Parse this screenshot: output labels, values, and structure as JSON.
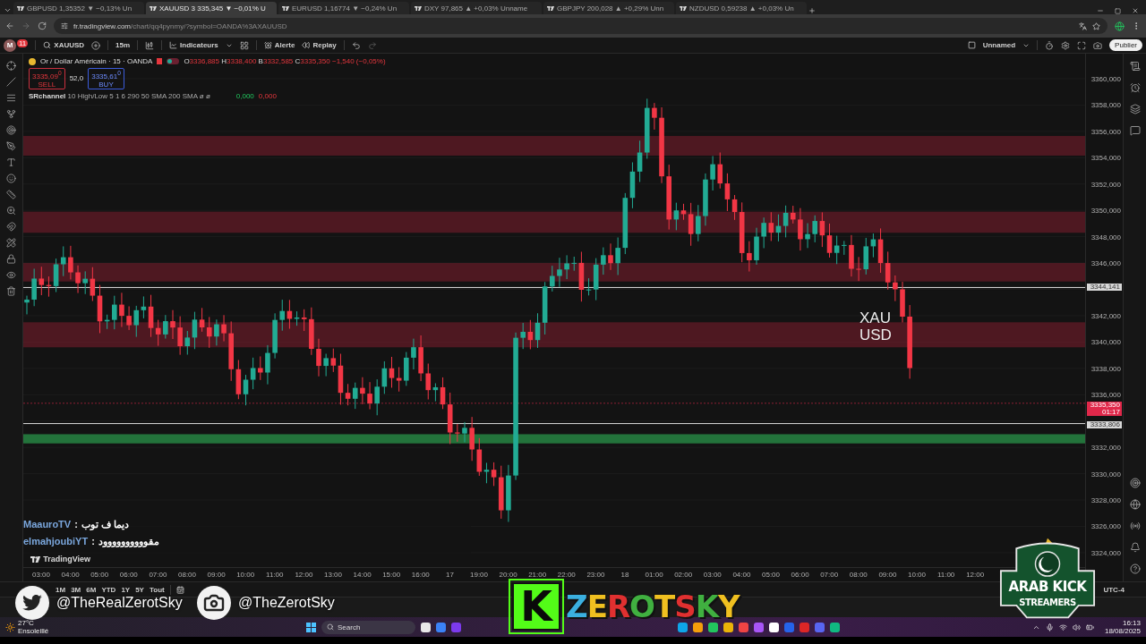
{
  "browser_tabs": [
    {
      "label": "GBPUSD 1,35352 ▼ −0,13% Un",
      "selected": false
    },
    {
      "label": "XAUUSD 3 335,345 ▼ −0,01% U",
      "selected": true
    },
    {
      "label": "EURUSD 1,16774 ▼ −0,24% Un",
      "selected": false
    },
    {
      "label": "DXY 97,865 ▲ +0,03% Unname",
      "selected": false
    },
    {
      "label": "GBPJPY 200,028 ▲ +0,29% Unn",
      "selected": false
    },
    {
      "label": "NZDUSD 0,59238 ▲ +0,03% Un",
      "selected": false
    }
  ],
  "address_bar": {
    "host": "fr.tradingview.com",
    "path": "/chart/qq4pynmy/?symbol=OANDA%3AXAUUSD"
  },
  "toolbar": {
    "avatar": "M",
    "avatar_badge": "11",
    "symbol": "XAUUSD",
    "interval": "15m",
    "indicators": "Indicateurs",
    "alert": "Alerte",
    "replay": "Replay",
    "layout_name": "Unnamed",
    "publish": "Publier"
  },
  "legend": {
    "title": "Or / Dollar Américain · 15 · OANDA",
    "ohlc": [
      {
        "label": "O",
        "value": "3336,885"
      },
      {
        "label": "H",
        "value": "3338,400"
      },
      {
        "label": "B",
        "value": "3332,585"
      },
      {
        "label": "C",
        "value": "3335,350"
      }
    ],
    "change": "−1,540 (−0,05%)",
    "sell": {
      "price": "3335,09$^{0}$",
      "label": "SELL"
    },
    "spread": "52,0",
    "buy": {
      "price": "3335,61$^{0}$",
      "label": "BUY"
    },
    "indicator": {
      "name": "SRchannel",
      "params": "10 High/Low 5 1 6 290 50 SMA 200 SMA",
      "marks": "ø ø",
      "value_up": "0,000",
      "value_down": "0,000"
    }
  },
  "price_axis": [
    "3360,000",
    "3358,000",
    "3356,000",
    "3354,000",
    "3352,000",
    "3350,000",
    "3348,000",
    "3346,000",
    "3342,000",
    "3340,000",
    "3338,000",
    "3336,000",
    "3332,000",
    "3330,000",
    "3328,000",
    "3326,000",
    "3324,000"
  ],
  "price_tags": [
    {
      "kind": "line",
      "value": "3344,141"
    },
    {
      "kind": "current",
      "value": "3335,350",
      "countdown": "01:17"
    },
    {
      "kind": "line",
      "value": "3333,806"
    }
  ],
  "time_axis": [
    "03:00",
    "04:00",
    "05:00",
    "06:00",
    "07:00",
    "08:00",
    "09:00",
    "10:00",
    "11:00",
    "12:00",
    "13:00",
    "14:00",
    "15:00",
    "16:00",
    "17",
    "19:00",
    "20:00",
    "21:00",
    "22:00",
    "23:00",
    "18",
    "01:00",
    "02:00",
    "03:00",
    "04:00",
    "05:00",
    "06:00",
    "07:00",
    "08:00",
    "09:00",
    "10:00",
    "11:00",
    "12:00"
  ],
  "chart_watermark": "TradingView",
  "range_buttons": [
    "1M",
    "3M",
    "6M",
    "YTD",
    "1Y",
    "5Y",
    "Tout"
  ],
  "timezone": "UTC-4",
  "overlay_symbol": {
    "line_1": "XAU",
    "line_2": "USD"
  },
  "chat": [
    {
      "user": "MaauroTV",
      "separator": ":",
      "message": "ديما ف توب"
    },
    {
      "user": "elmahjoubiYT",
      "separator": ":",
      "message": "مقوووووووووود"
    }
  ],
  "social": [
    {
      "kind": "twitter",
      "handle": "@TheRealZerotSky"
    },
    {
      "kind": "instagram",
      "handle": "@TheZerotSky"
    }
  ],
  "streamer_logo": {
    "mark": "K",
    "name": "ZEROTSKY"
  },
  "community_badge": {
    "line_1": "ARAB KICK",
    "line_2": "STREAMERS"
  },
  "taskbar": {
    "temperature": "27°C",
    "weather": "Ensoleillé",
    "search": "Search",
    "time": "16:13",
    "date": "18/08/2025"
  }
}
